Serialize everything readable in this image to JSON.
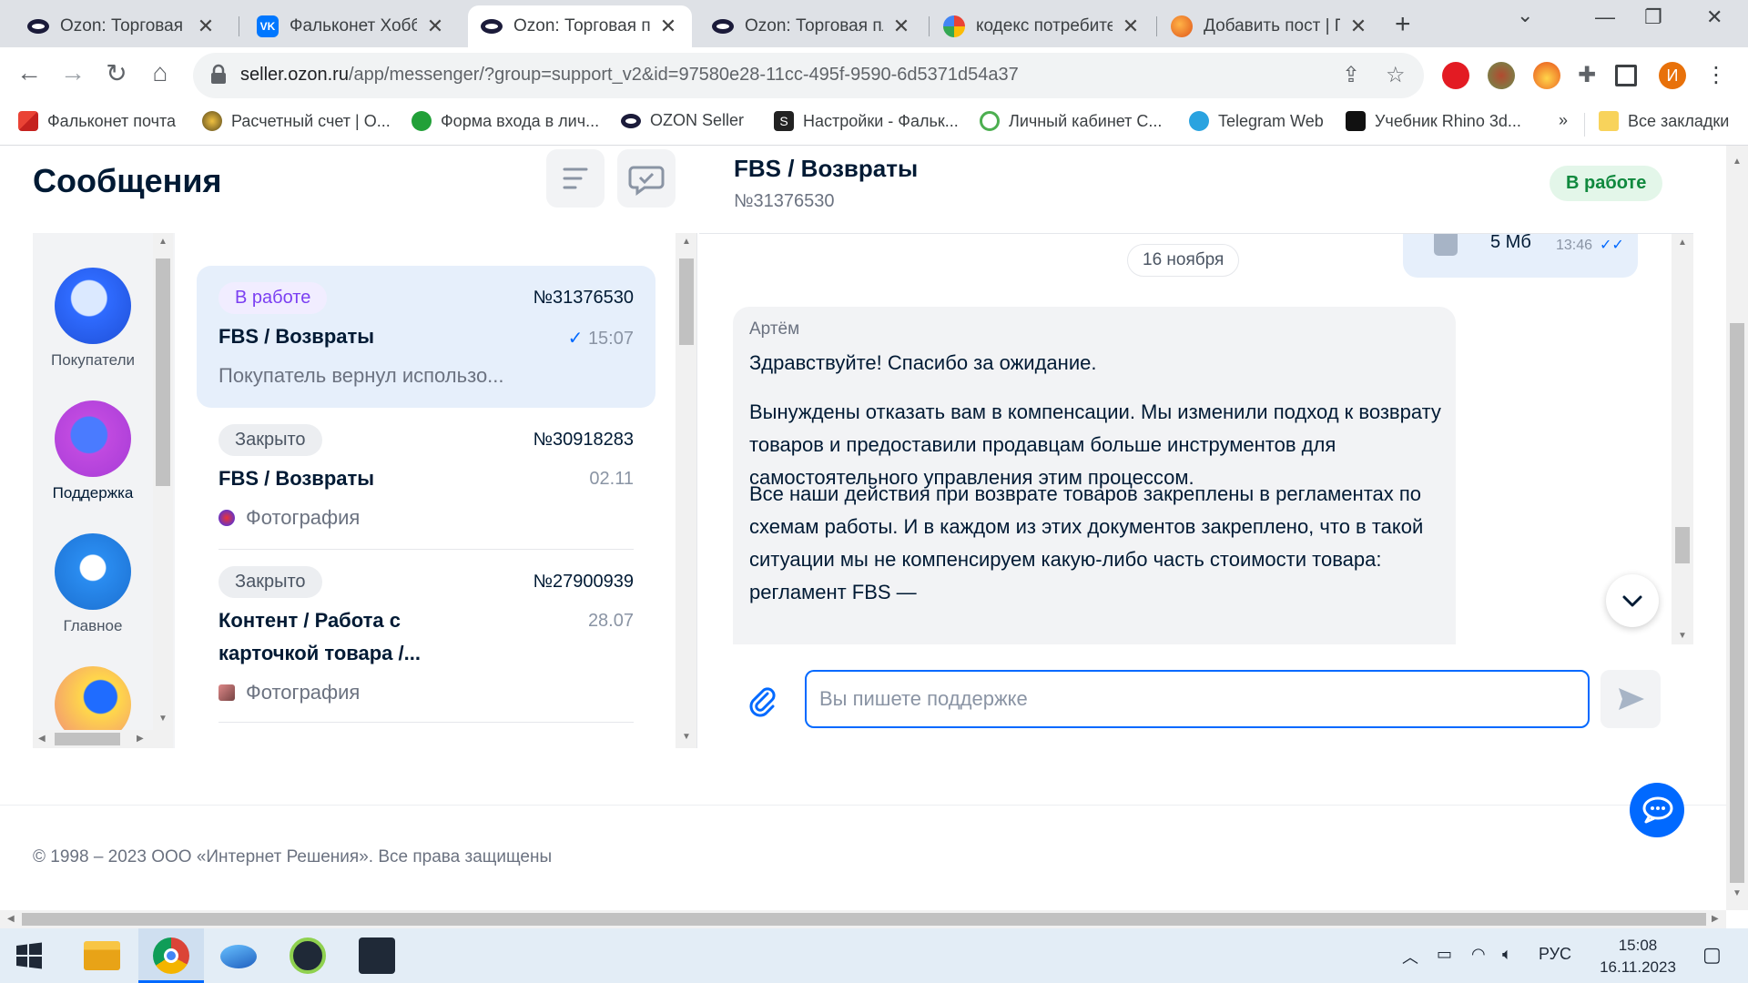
{
  "browser": {
    "tabs": [
      {
        "title": "Ozon: Торговая пл",
        "icon": "ozon-logo-icon",
        "active": false
      },
      {
        "title": "Фальконет Хобби",
        "icon": "vk-logo-icon",
        "active": false
      },
      {
        "title": "Ozon: Торговая пл",
        "icon": "ozon-logo-icon",
        "active": true
      },
      {
        "title": "Ozon: Торговая пл",
        "icon": "ozon-logo-icon",
        "active": false
      },
      {
        "title": "кодекс потребите",
        "icon": "google-logo-icon",
        "active": false
      },
      {
        "title": "Добавить пост | П",
        "icon": "pikabu-logo-icon",
        "active": false
      }
    ],
    "url_domain": "seller.ozon.ru",
    "url_path": "/app/messenger/?group=support_v2&id=97580e28-11cc-495f-9590-6d5371d54a37",
    "profile_initial": "И",
    "bookmarks": [
      {
        "label": "Фальконет почта",
        "icon": "gmail-icon"
      },
      {
        "label": "Расчетный счет | О...",
        "icon": "bank-icon"
      },
      {
        "label": "Форма входа в лич...",
        "icon": "sber-icon"
      },
      {
        "label": "OZON Seller",
        "icon": "ozon-logo-icon"
      },
      {
        "label": "Настройки - Фальк...",
        "icon": "s-logo-icon"
      },
      {
        "label": "Личный кабинет С...",
        "icon": "check-icon"
      },
      {
        "label": "Telegram Web",
        "icon": "telegram-icon"
      },
      {
        "label": "Учебник Rhino 3d...",
        "icon": "rhino-icon"
      }
    ],
    "bookmarks_overflow": "»",
    "all_bookmarks": "Все закладки"
  },
  "page": {
    "title": "Сообщения",
    "rail": [
      {
        "label": "Покупатели",
        "icon": "buyers-icon"
      },
      {
        "label": "Поддержка",
        "icon": "support-headset-icon",
        "active": true
      },
      {
        "label": "Главное",
        "icon": "news-envelope-icon"
      },
      {
        "label": "",
        "icon": "growth-arrow-icon"
      }
    ],
    "chats": [
      {
        "badge": "В работе",
        "number": "№31376530",
        "title": "FBS / Возвраты",
        "time": "15:07",
        "preview": "Покупатель вернул использо..."
      },
      {
        "badge": "Закрыто",
        "number": "№30918283",
        "title": "FBS / Возвраты",
        "time": "02.11",
        "preview": "Фотография"
      },
      {
        "badge": "Закрыто",
        "number": "№27900939",
        "title_line1": "Контент / Работа с",
        "title_line2": "карточкой товара /...",
        "time": "28.07",
        "preview": "Фотография"
      }
    ],
    "thread": {
      "title": "FBS / Возвраты",
      "number": "№31376530",
      "status": "В работе",
      "date_separator": "16 ноября",
      "file_size": "5 Мб",
      "file_time": "13:46",
      "author": "Артём",
      "paragraphs": [
        "Здравствуйте! Спасибо за ожидание.",
        "Вынуждены отказать вам в компенсации. Мы изменили подход к возврату товаров и предоставили продавцам больше инструментов для самостоятельного управления этим процессом.",
        "Все наши действия при возврате товаров закреплены в регламентах по схемам работы. И в каждом из этих документов закреплено, что в такой ситуации мы не компенсируем какую-либо часть стоимости товара: регламент FBS —"
      ]
    },
    "composer": {
      "placeholder": "Вы пишете поддержке",
      "value": ""
    },
    "footer": "© 1998 – 2023 ООО «Интернет Решения». Все права защищены"
  },
  "taskbar": {
    "lang": "РУС",
    "time": "15:08",
    "date": "16.11.2023"
  },
  "colors": {
    "accent": "#0069ff",
    "status_work_bg": "#e3f6e9",
    "status_work_text": "#10893e",
    "badge_work_text": "#7b3ff2"
  }
}
